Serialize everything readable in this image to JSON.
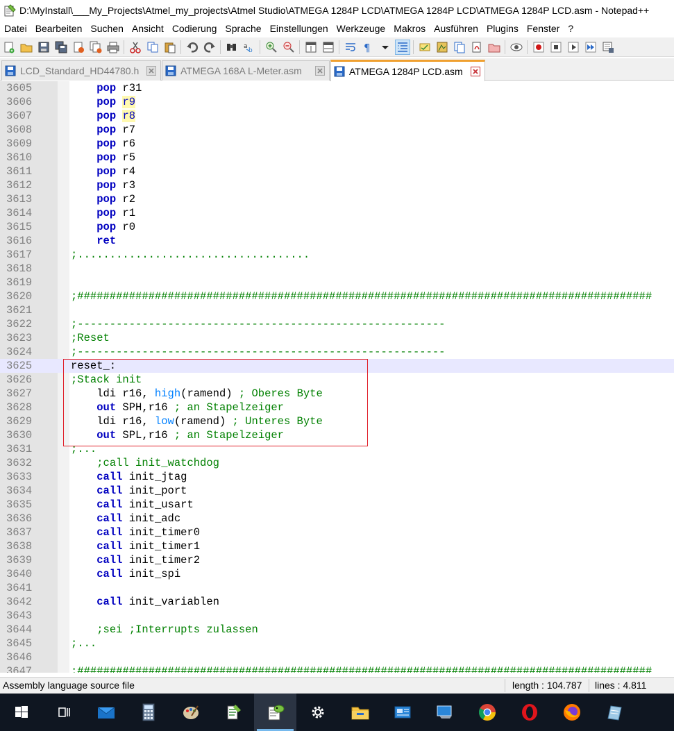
{
  "window": {
    "title": "D:\\MyInstall\\___My_Projects\\Atmel_my_projects\\Atmel Studio\\ATMEGA 1284P LCD\\ATMEGA 1284P LCD\\ATMEGA 1284P LCD.asm - Notepad++"
  },
  "menu": [
    "Datei",
    "Bearbeiten",
    "Suchen",
    "Ansicht",
    "Codierung",
    "Sprache",
    "Einstellungen",
    "Werkzeuge",
    "Makros",
    "Ausführen",
    "Plugins",
    "Fenster",
    "?"
  ],
  "toolbar": {
    "icons": [
      "new-file-icon",
      "open-file-icon",
      "save-icon",
      "save-all-icon",
      "close-icon",
      "close-all-icon",
      "print-icon",
      "cut-icon",
      "copy-icon",
      "paste-icon",
      "undo-icon",
      "redo-icon",
      "find-icon",
      "replace-icon",
      "zoom-in-icon",
      "zoom-out-icon",
      "sync-v-icon",
      "sync-h-icon",
      "word-wrap-icon",
      "show-all-chars-icon",
      "indent-guide-icon",
      "udl-icon",
      "doc-map-icon",
      "func-list-icon",
      "folder-workspace-icon",
      "monitor-icon",
      "record-macro-icon",
      "stop-record-icon",
      "play-macro-icon",
      "run-macro-multiple-icon",
      "save-macro-icon"
    ]
  },
  "tabs": [
    {
      "label": "LCD_Standard_HD44780.h",
      "active": false
    },
    {
      "label": "ATMEGA 168A L-Meter.asm",
      "active": false
    },
    {
      "label": "ATMEGA 1284P LCD.asm",
      "active": true
    }
  ],
  "editor": {
    "current_line": 3625,
    "lines": [
      {
        "n": "3605",
        "segs": [
          [
            "    ",
            ""
          ],
          [
            "pop",
            "kw"
          ],
          [
            " r31",
            ""
          ]
        ]
      },
      {
        "n": "3606",
        "segs": [
          [
            "    ",
            ""
          ],
          [
            "pop",
            "kw"
          ],
          [
            " ",
            ""
          ],
          [
            "r9",
            "hl"
          ]
        ]
      },
      {
        "n": "3607",
        "segs": [
          [
            "    ",
            ""
          ],
          [
            "pop",
            "kw"
          ],
          [
            " ",
            ""
          ],
          [
            "r8",
            "hl"
          ]
        ]
      },
      {
        "n": "3608",
        "segs": [
          [
            "    ",
            ""
          ],
          [
            "pop",
            "kw"
          ],
          [
            " r7",
            ""
          ]
        ]
      },
      {
        "n": "3609",
        "segs": [
          [
            "    ",
            ""
          ],
          [
            "pop",
            "kw"
          ],
          [
            " r6",
            ""
          ]
        ]
      },
      {
        "n": "3610",
        "segs": [
          [
            "    ",
            ""
          ],
          [
            "pop",
            "kw"
          ],
          [
            " r5",
            ""
          ]
        ]
      },
      {
        "n": "3611",
        "segs": [
          [
            "    ",
            ""
          ],
          [
            "pop",
            "kw"
          ],
          [
            " r4",
            ""
          ]
        ]
      },
      {
        "n": "3612",
        "segs": [
          [
            "    ",
            ""
          ],
          [
            "pop",
            "kw"
          ],
          [
            " r3",
            ""
          ]
        ]
      },
      {
        "n": "3613",
        "segs": [
          [
            "    ",
            ""
          ],
          [
            "pop",
            "kw"
          ],
          [
            " r2",
            ""
          ]
        ]
      },
      {
        "n": "3614",
        "segs": [
          [
            "    ",
            ""
          ],
          [
            "pop",
            "kw"
          ],
          [
            " r1",
            ""
          ]
        ]
      },
      {
        "n": "3615",
        "segs": [
          [
            "    ",
            ""
          ],
          [
            "pop",
            "kw"
          ],
          [
            " r0",
            ""
          ]
        ]
      },
      {
        "n": "3616",
        "segs": [
          [
            "    ",
            ""
          ],
          [
            "ret",
            "kw"
          ]
        ]
      },
      {
        "n": "3617",
        "segs": [
          [
            ";....................................",
            "cm"
          ]
        ]
      },
      {
        "n": "3618",
        "segs": []
      },
      {
        "n": "3619",
        "segs": []
      },
      {
        "n": "3620",
        "segs": [
          [
            ";#########################################################################################",
            "cm"
          ]
        ]
      },
      {
        "n": "3621",
        "segs": []
      },
      {
        "n": "3622",
        "segs": [
          [
            ";---------------------------------------------------------",
            "cm"
          ]
        ]
      },
      {
        "n": "3623",
        "segs": [
          [
            ";Reset",
            "cm"
          ]
        ]
      },
      {
        "n": "3624",
        "segs": [
          [
            ";---------------------------------------------------------",
            "cm"
          ]
        ]
      },
      {
        "n": "3625",
        "segs": [
          [
            "reset_:",
            "lbl"
          ]
        ]
      },
      {
        "n": "3626",
        "segs": [
          [
            ";Stack init",
            "cm"
          ]
        ]
      },
      {
        "n": "3627",
        "segs": [
          [
            "    ldi r16, ",
            ""
          ],
          [
            "high",
            "fn"
          ],
          [
            "(ramend) ",
            ""
          ],
          [
            "; Oberes Byte",
            "cm"
          ]
        ]
      },
      {
        "n": "3628",
        "segs": [
          [
            "    ",
            ""
          ],
          [
            "out",
            "kw"
          ],
          [
            " SPH,r16 ",
            ""
          ],
          [
            "; an Stapelzeiger",
            "cm"
          ]
        ]
      },
      {
        "n": "3629",
        "segs": [
          [
            "    ldi r16, ",
            ""
          ],
          [
            "low",
            "fn"
          ],
          [
            "(ramend) ",
            ""
          ],
          [
            "; Unteres Byte",
            "cm"
          ]
        ]
      },
      {
        "n": "3630",
        "segs": [
          [
            "    ",
            ""
          ],
          [
            "out",
            "kw"
          ],
          [
            " SPL,r16 ",
            ""
          ],
          [
            "; an Stapelzeiger",
            "cm"
          ]
        ]
      },
      {
        "n": "3631",
        "segs": [
          [
            ";...",
            "cm"
          ]
        ]
      },
      {
        "n": "3632",
        "segs": [
          [
            "    ",
            ""
          ],
          [
            ";call init_watchdog",
            "cm"
          ]
        ]
      },
      {
        "n": "3633",
        "segs": [
          [
            "    ",
            ""
          ],
          [
            "call",
            "kw"
          ],
          [
            " init_jtag",
            ""
          ]
        ]
      },
      {
        "n": "3634",
        "segs": [
          [
            "    ",
            ""
          ],
          [
            "call",
            "kw"
          ],
          [
            " init_port",
            ""
          ]
        ]
      },
      {
        "n": "3635",
        "segs": [
          [
            "    ",
            ""
          ],
          [
            "call",
            "kw"
          ],
          [
            " init_usart",
            ""
          ]
        ]
      },
      {
        "n": "3636",
        "segs": [
          [
            "    ",
            ""
          ],
          [
            "call",
            "kw"
          ],
          [
            " init_adc",
            ""
          ]
        ]
      },
      {
        "n": "3637",
        "segs": [
          [
            "    ",
            ""
          ],
          [
            "call",
            "kw"
          ],
          [
            " init_timer0",
            ""
          ]
        ]
      },
      {
        "n": "3638",
        "segs": [
          [
            "    ",
            ""
          ],
          [
            "call",
            "kw"
          ],
          [
            " init_timer1",
            ""
          ]
        ]
      },
      {
        "n": "3639",
        "segs": [
          [
            "    ",
            ""
          ],
          [
            "call",
            "kw"
          ],
          [
            " init_timer2",
            ""
          ]
        ]
      },
      {
        "n": "3640",
        "segs": [
          [
            "    ",
            ""
          ],
          [
            "call",
            "kw"
          ],
          [
            " init_spi",
            ""
          ]
        ]
      },
      {
        "n": "3641",
        "segs": []
      },
      {
        "n": "3642",
        "segs": [
          [
            "    ",
            ""
          ],
          [
            "call",
            "kw"
          ],
          [
            " init_variablen",
            ""
          ]
        ]
      },
      {
        "n": "3643",
        "segs": []
      },
      {
        "n": "3644",
        "segs": [
          [
            "    ",
            ""
          ],
          [
            ";sei ;Interrupts zulassen",
            "cm"
          ]
        ]
      },
      {
        "n": "3645",
        "segs": [
          [
            ";...",
            "cm"
          ]
        ]
      },
      {
        "n": "3646",
        "segs": []
      },
      {
        "n": "3647",
        "segs": [
          [
            ";#########################################################################################",
            "cm"
          ]
        ]
      }
    ]
  },
  "statusbar": {
    "file_type": "Assembly language source file",
    "length": "length : 104.787",
    "lines": "lines : 4.811"
  },
  "taskbar": {
    "items": [
      "start-windows-icon",
      "task-view-icon",
      "mail-icon",
      "calculator-icon",
      "paint-icon",
      "notepad-icon",
      "notepadpp-icon",
      "settings-icon",
      "file-explorer-icon",
      "control-panel-icon",
      "remote-desktop-icon",
      "chrome-icon",
      "opera-icon",
      "firefox-icon",
      "notes-icon"
    ],
    "active": "notepadpp-icon"
  }
}
